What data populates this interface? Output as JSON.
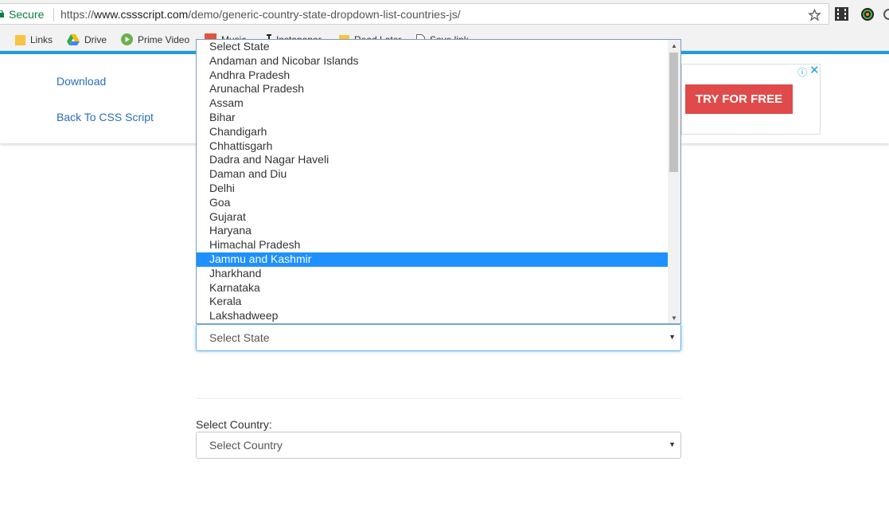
{
  "browser": {
    "secure_label": "Secure",
    "url_scheme": "https://",
    "url_host": "www.cssscript.com",
    "url_path": "/demo/generic-country-state-dropdown-list-countries-js/"
  },
  "bookmarks": [
    {
      "label": "Links",
      "icon": "folder-icon"
    },
    {
      "label": "Drive",
      "icon": "drive-icon"
    },
    {
      "label": "Prime Video",
      "icon": "play-icon"
    },
    {
      "label": "Music",
      "icon": "music-icon"
    },
    {
      "label": "Instapaper",
      "icon": "instapaper-icon"
    },
    {
      "label": "Read Later",
      "icon": "folder-icon"
    },
    {
      "label": "Save link",
      "icon": "page-icon"
    }
  ],
  "header": {
    "download_label": "Download",
    "back_label": "Back To CSS Script"
  },
  "ad": {
    "cta_label": "TRY FOR FREE",
    "info_glyph": "ⓘ",
    "close_glyph": "✕"
  },
  "state_select": {
    "value": "Select State",
    "caret": "▼",
    "options": [
      "Select State",
      "Andaman and Nicobar Islands",
      "Andhra Pradesh",
      "Arunachal Pradesh",
      "Assam",
      "Bihar",
      "Chandigarh",
      "Chhattisgarh",
      "Dadra and Nagar Haveli",
      "Daman and Diu",
      "Delhi",
      "Goa",
      "Gujarat",
      "Haryana",
      "Himachal Pradesh",
      "Jammu and Kashmir",
      "Jharkhand",
      "Karnataka",
      "Kerala",
      "Lakshadweep"
    ],
    "highlighted": "Jammu and Kashmir"
  },
  "country_select": {
    "label": "Select Country:",
    "value": "Select Country",
    "caret": "▼"
  },
  "colors": {
    "accent_blue": "#1e9ed9",
    "highlight": "#1e90ff",
    "cta_red": "#e04a4a",
    "link_blue": "#2a6ebb",
    "secure_green": "#0b8043"
  }
}
